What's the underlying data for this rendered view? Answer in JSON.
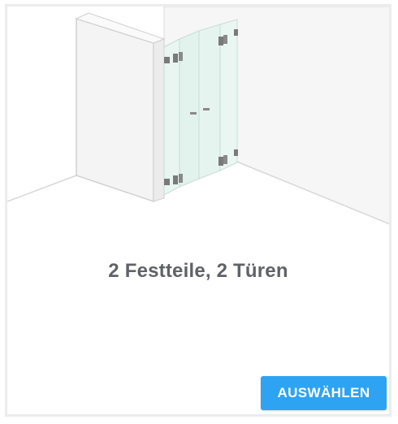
{
  "product": {
    "caption": "2 Festteile, 2 Türen",
    "select_label": "AUSWÄHLEN"
  },
  "colors": {
    "accent": "#2ea3f2",
    "caption_text": "#5f6368",
    "card_border": "#ececec",
    "wall_fill": "#f4f4f4",
    "glass_fill": "#e4f3ef",
    "hardware": "#7a7a7a"
  },
  "icons": {
    "illustration": "shower-enclosure-illustration"
  }
}
